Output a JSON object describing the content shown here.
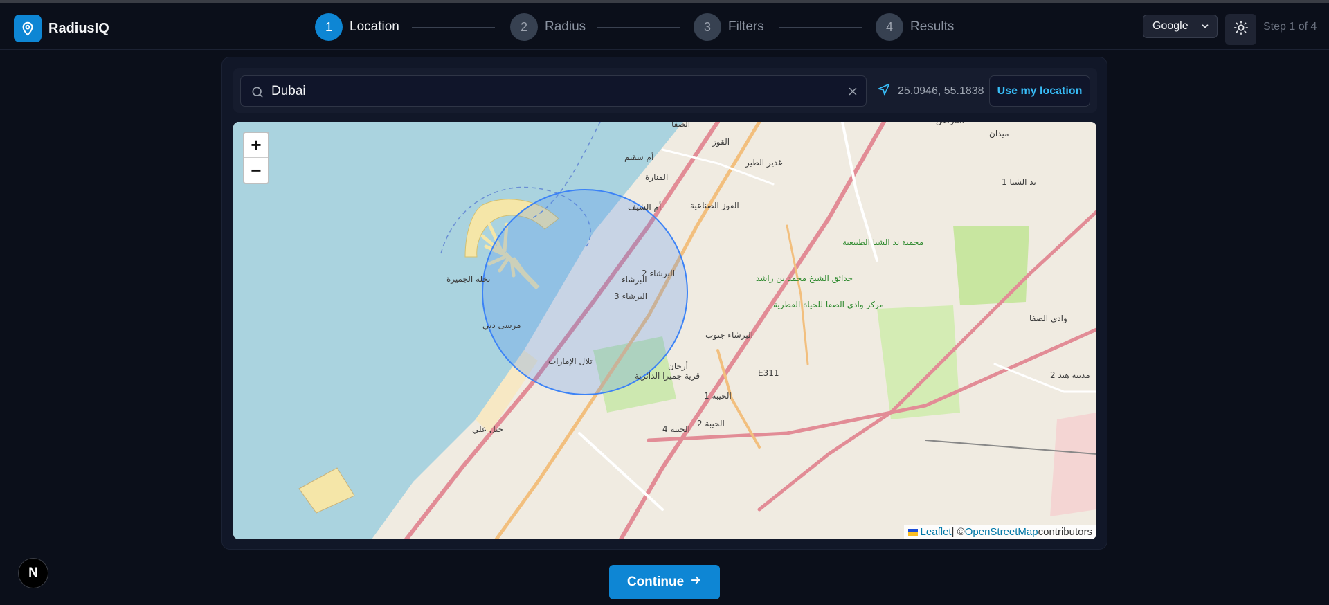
{
  "app": {
    "name": "RadiusIQ",
    "logo_icon": "map-pin-icon",
    "accent": "#0e86d4"
  },
  "stepper": {
    "steps": [
      {
        "num": "1",
        "label": "Location",
        "active": true
      },
      {
        "num": "2",
        "label": "Radius",
        "active": false
      },
      {
        "num": "3",
        "label": "Filters",
        "active": false
      },
      {
        "num": "4",
        "label": "Results",
        "active": false
      }
    ]
  },
  "header": {
    "provider": "Google",
    "theme_icon": "sun-icon",
    "step_count": "Step 1 of 4"
  },
  "search": {
    "value": "Dubai",
    "search_icon": "search-icon",
    "clear_icon": "close-icon"
  },
  "location": {
    "coords": "25.0946, 55.1838",
    "button_label": "Use my location",
    "icon": "navigation-arrow-icon"
  },
  "map": {
    "zoom_in": "+",
    "zoom_out": "−",
    "attribution": {
      "leaflet": "Leaflet",
      "sep": " | © ",
      "osm": "OpenStreetMap",
      "suffix": " contributors"
    },
    "labels": [
      "نخلة الجميرة",
      "مرسى دبي",
      "تلال الإمارات",
      "البرشاء",
      "البرشاء 2",
      "البرشاء 3",
      "البرشاء جنوب",
      "قرية جميرا الدائرية",
      "أم سقيم",
      "المنارة",
      "أم الشيف",
      "القوز الصناعية",
      "القوز",
      "غدير الطير",
      "حدائق الشيخ محمد بن راشد",
      "محمية ند الشبا الطبيعية",
      "مركز وادي الصفا للحياة الفطرية",
      "وادي الصفا",
      "مدينة هند 2",
      "الحيبة 1",
      "الحيبة 2",
      "الحيبة 4",
      "جبل علي",
      "ند الشبا 1",
      "المركض",
      "الصفا",
      "ميدان",
      "أرجان",
      "E311"
    ]
  },
  "footer": {
    "continue_label": "Continue",
    "continue_icon": "arrow-right-icon",
    "badge": "N"
  }
}
